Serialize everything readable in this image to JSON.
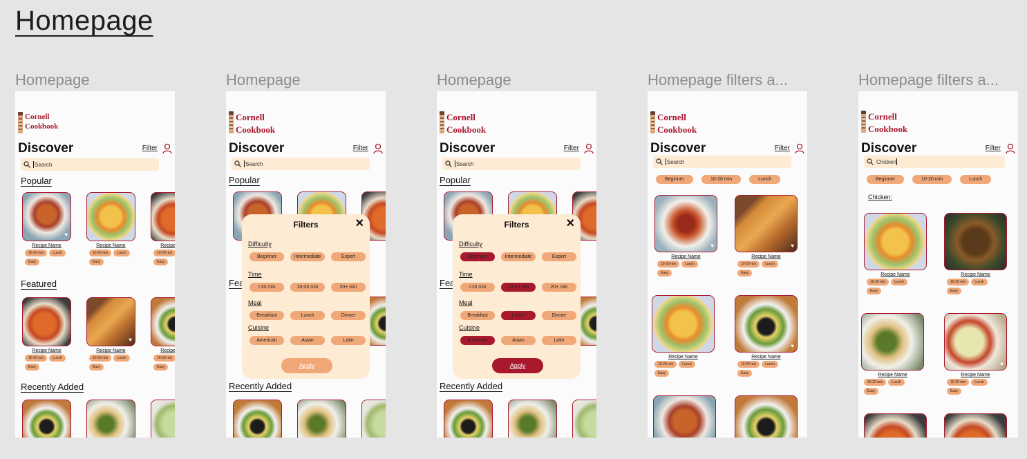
{
  "page_title": "Homepage",
  "frames": [
    {
      "label": "Homepage"
    },
    {
      "label": "Homepage"
    },
    {
      "label": "Homepage"
    },
    {
      "label": "Homepage filters a..."
    },
    {
      "label": "Homepage filters a..."
    }
  ],
  "app": {
    "logo_line1": "Cornell",
    "logo_line2": "Cookbook",
    "discover": "Discover",
    "filter": "Filter",
    "search_placeholder": "Search",
    "search_chicken": "Chicken",
    "popular": "Popular",
    "featured": "Featured",
    "recently_added": "Recently Added",
    "recipe_name": "Recipe Name",
    "tag_time": "10-20 min",
    "tag_meal": "Lunch",
    "tag_difficulty": "Easy",
    "heart_icon": "heart-icon",
    "chicken_label": "Chicken:"
  },
  "filters": {
    "title": "Filters",
    "close": "✕",
    "difficulty_label": "Difficulty",
    "difficulty": [
      "Beginner",
      "Intermediate",
      "Expert"
    ],
    "time_label": "Time",
    "time": [
      "<10 min",
      "10-20 min",
      "20+ min"
    ],
    "meal_label": "Meal",
    "meal": [
      "Breakfast",
      "Lunch",
      "Dinner"
    ],
    "cuisine_label": "Cuisine",
    "cuisine": [
      "American",
      "Asian",
      "Latin"
    ],
    "apply": "Apply"
  },
  "active_filters": [
    "Beginner",
    "10-20 min",
    "Lunch"
  ],
  "colors": {
    "brand": "#a8192e",
    "chip": "#f0a878",
    "search_bg": "#fdebd3",
    "canvas": "#e5e5e5"
  }
}
